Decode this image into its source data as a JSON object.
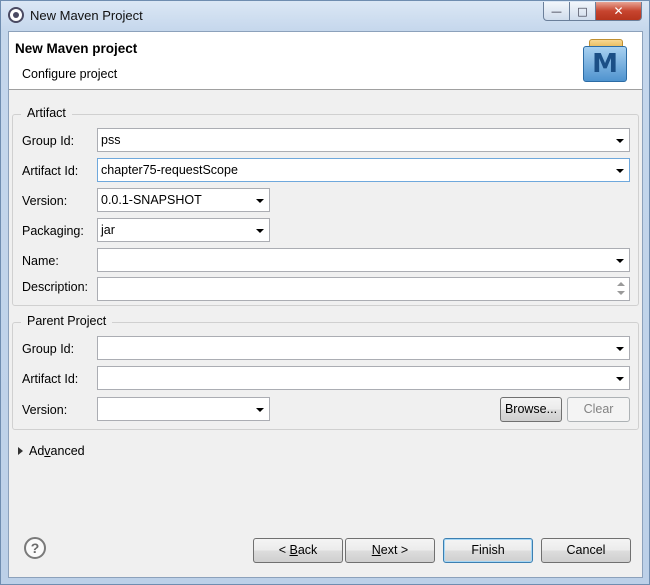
{
  "window": {
    "title": "New Maven Project",
    "buttons": {
      "minimize": "—",
      "maximize": "□",
      "close": "✕"
    }
  },
  "header": {
    "title": "New Maven project",
    "subtitle": "Configure project",
    "logo_letter": "M"
  },
  "artifact": {
    "legend": "Artifact",
    "group_id_label": "Group Id:",
    "group_id_value": "pss",
    "artifact_id_label": "Artifact Id:",
    "artifact_id_value": "chapter75-requestScope",
    "version_label": "Version:",
    "version_value": "0.0.1-SNAPSHOT",
    "packaging_label": "Packaging:",
    "packaging_value": "jar",
    "name_label": "Name:",
    "name_value": "",
    "description_label": "Description:",
    "description_value": ""
  },
  "parent": {
    "legend": "Parent Project",
    "group_id_label": "Group Id:",
    "group_id_value": "",
    "artifact_id_label": "Artifact Id:",
    "artifact_id_value": "",
    "version_label": "Version:",
    "version_value": "",
    "browse_label": "Browse...",
    "clear_label": "Clear"
  },
  "advanced": {
    "label_prefix": "Ad",
    "label_mnemonic": "v",
    "label_suffix": "anced"
  },
  "footer": {
    "help_glyph": "?",
    "back": {
      "prefix": "< ",
      "mnemonic": "B",
      "suffix": "ack"
    },
    "next": {
      "mnemonic": "N",
      "suffix": "ext >"
    },
    "finish_label": "Finish",
    "cancel_label": "Cancel"
  }
}
